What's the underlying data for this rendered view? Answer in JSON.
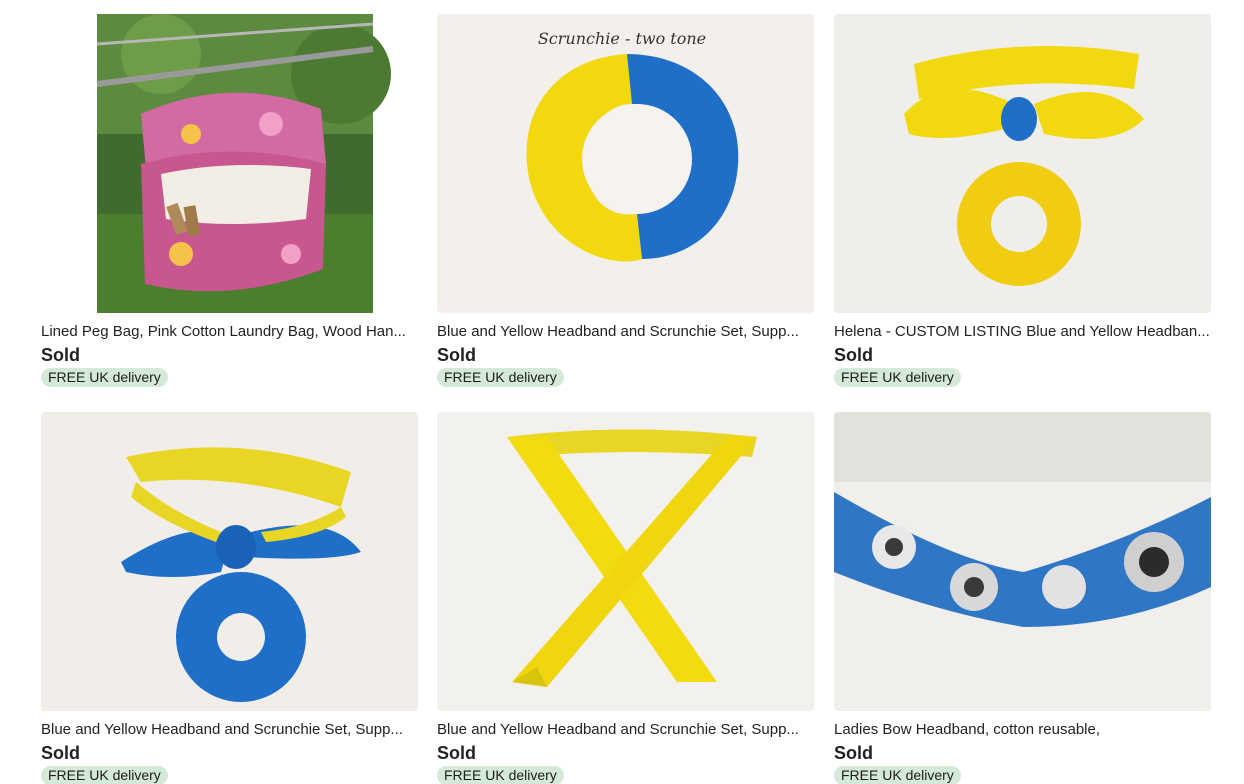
{
  "listings": [
    {
      "title": "Lined Peg Bag, Pink Cotton Laundry Bag, Wood Han...",
      "price": "Sold",
      "delivery": "FREE UK delivery",
      "image": "pink-floral-peg-bag-photo"
    },
    {
      "title": "Blue and Yellow Headband and Scrunchie Set, Supp...",
      "price": "Sold",
      "delivery": "FREE UK delivery",
      "image": "blue-yellow-scrunchie-photo",
      "image_caption": "Scrunchie - two tone"
    },
    {
      "title": "Helena - CUSTOM LISTING Blue and Yellow Headban...",
      "price": "Sold",
      "delivery": "FREE UK delivery",
      "image": "yellow-headband-and-scrunchie-photo"
    },
    {
      "title": "Blue and Yellow Headband and Scrunchie Set, Supp...",
      "price": "Sold",
      "delivery": "FREE UK delivery",
      "image": "yellow-blue-headband-blue-scrunchie-photo"
    },
    {
      "title": "Blue and Yellow Headband and Scrunchie Set, Supp...",
      "price": "Sold",
      "delivery": "FREE UK delivery",
      "image": "yellow-headband-crossed-photo"
    },
    {
      "title": "Ladies Bow Headband, cotton reusable,",
      "price": "Sold",
      "delivery": "FREE UK delivery",
      "image": "blue-rose-print-headband-photo"
    }
  ],
  "colors": {
    "badge_bg": "#d4e9d7",
    "text": "#222222",
    "yellow": "#f2d90f",
    "blue": "#1f6fc9",
    "pink": "#c9578f"
  }
}
